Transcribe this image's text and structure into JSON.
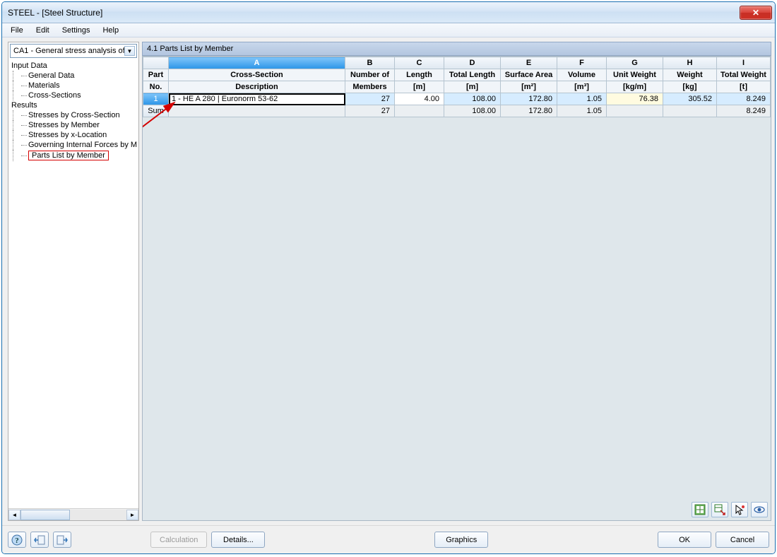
{
  "window": {
    "title": "STEEL - [Steel Structure]"
  },
  "menu": {
    "items": [
      "File",
      "Edit",
      "Settings",
      "Help"
    ]
  },
  "sidebar": {
    "combo_value": "CA1 - General stress analysis of",
    "groups": [
      {
        "header": "Input Data",
        "items": [
          "General Data",
          "Materials",
          "Cross-Sections"
        ]
      },
      {
        "header": "Results",
        "items": [
          "Stresses by Cross-Section",
          "Stresses by Member",
          "Stresses by x-Location",
          "Governing Internal Forces by M",
          "Parts List by Member"
        ]
      }
    ]
  },
  "panel": {
    "title": "4.1 Parts List by Member"
  },
  "grid": {
    "letter_cols": [
      "A",
      "B",
      "C",
      "D",
      "E",
      "F",
      "G",
      "H",
      "I"
    ],
    "headers_line1": [
      "Part",
      "Cross-Section",
      "Number of",
      "Length",
      "Total Length",
      "Surface Area",
      "Volume",
      "Unit Weight",
      "Weight",
      "Total Weight"
    ],
    "headers_line2": [
      "No.",
      "Description",
      "Members",
      "[m]",
      "[m]",
      "[m²]",
      "[m³]",
      "[kg/m]",
      "[kg]",
      "[t]"
    ],
    "rows": [
      {
        "no": "1",
        "desc": "1 - HE A 280 | Euronorm 53-62",
        "members": "27",
        "length": "4.00",
        "total_length": "108.00",
        "surface": "172.80",
        "volume": "1.05",
        "unit_weight": "76.38",
        "weight": "305.52",
        "total_weight": "8.249"
      }
    ],
    "sum": {
      "label": "Sum",
      "members": "27",
      "length": "",
      "total_length": "108.00",
      "surface": "172.80",
      "volume": "1.05",
      "unit_weight": "",
      "weight": "",
      "total_weight": "8.249"
    }
  },
  "buttons": {
    "calculation": "Calculation",
    "details": "Details...",
    "graphics": "Graphics",
    "ok": "OK",
    "cancel": "Cancel"
  }
}
